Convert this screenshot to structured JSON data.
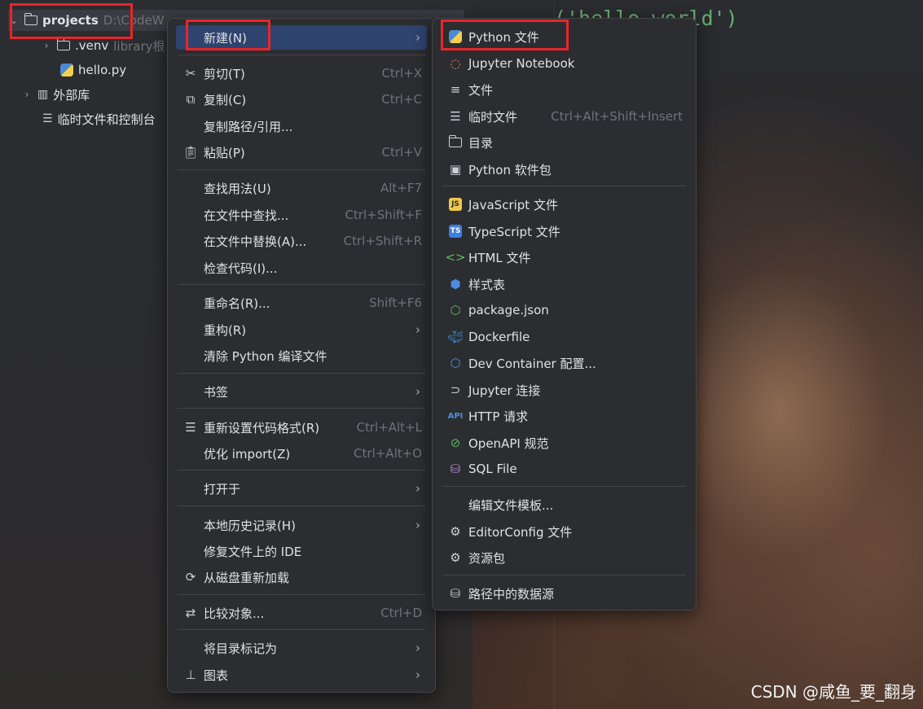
{
  "code": {
    "text": "print('hello world')",
    "visible_fragment": "('hello world')"
  },
  "watermark": "CSDN @咸鱼_要_翻身",
  "tree": {
    "projects": {
      "label": "projects",
      "path": "D:\\CodeW"
    },
    "venv": {
      "label": ".venv",
      "note": "library根"
    },
    "hello": {
      "label": "hello.py"
    },
    "external": {
      "label": "外部库"
    },
    "scratch": {
      "label": "临时文件和控制台"
    }
  },
  "context_menu": {
    "new": "新建(N)",
    "cut": "剪切(T)",
    "cut_sc": "Ctrl+X",
    "copy": "复制(C)",
    "copy_sc": "Ctrl+C",
    "copy_path": "复制路径/引用...",
    "paste": "粘贴(P)",
    "paste_sc": "Ctrl+V",
    "find_usages": "查找用法(U)",
    "find_usages_sc": "Alt+F7",
    "find_in_files": "在文件中查找...",
    "find_in_files_sc": "Ctrl+Shift+F",
    "replace_in_files": "在文件中替换(A)...",
    "replace_in_files_sc": "Ctrl+Shift+R",
    "inspect": "检查代码(I)...",
    "rename": "重命名(R)...",
    "rename_sc": "Shift+F6",
    "refactor": "重构(R)",
    "clean_python": "清除 Python 编译文件",
    "bookmarks": "书签",
    "reformat": "重新设置代码格式(R)",
    "reformat_sc": "Ctrl+Alt+L",
    "optimize": "优化 import(Z)",
    "optimize_sc": "Ctrl+Alt+O",
    "open_in": "打开于",
    "local_history": "本地历史记录(H)",
    "repair_ide": "修复文件上的 IDE",
    "reload": "从磁盘重新加载",
    "compare": "比较对象...",
    "compare_sc": "Ctrl+D",
    "mark_dir": "将目录标记为",
    "diagrams": "图表"
  },
  "submenu": {
    "python_file": "Python 文件",
    "jupyter": "Jupyter Notebook",
    "file": "文件",
    "scratch": "临时文件",
    "scratch_sc": "Ctrl+Alt+Shift+Insert",
    "directory": "目录",
    "python_package": "Python 软件包",
    "js": "JavaScript 文件",
    "ts": "TypeScript 文件",
    "html": "HTML 文件",
    "css": "样式表",
    "package_json": "package.json",
    "dockerfile": "Dockerfile",
    "devcontainer": "Dev Container 配置...",
    "jupyter_conn": "Jupyter 连接",
    "http": "HTTP 请求",
    "openapi": "OpenAPI 规范",
    "sql": "SQL File",
    "edit_templates": "编辑文件模板...",
    "editorconfig": "EditorConfig 文件",
    "resource_bundle": "资源包",
    "datasource": "路径中的数据源"
  },
  "badges": {
    "js": "JS",
    "ts": "TS",
    "api": "API"
  },
  "colors": {
    "highlight": "#2e436e",
    "red_box": "#e8262b",
    "string": "#6aab73",
    "menu_bg": "#2b2d30"
  }
}
